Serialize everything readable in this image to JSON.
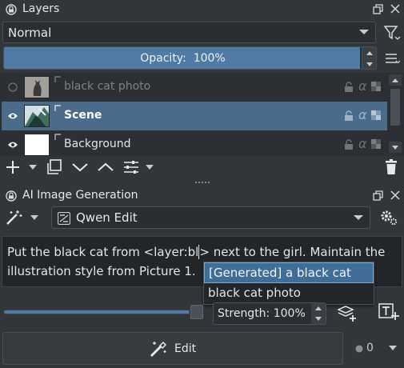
{
  "layers_docker": {
    "title": "Layers",
    "blend_mode": "Normal",
    "opacity_label": "Opacity:  100%",
    "opacity_fraction": 1.0,
    "layers": [
      {
        "name": "black cat photo",
        "visible": false,
        "selected": false
      },
      {
        "name": "Scene",
        "visible": true,
        "selected": true
      },
      {
        "name": "Background",
        "visible": true,
        "selected": false
      }
    ],
    "alpha_glyph": "α"
  },
  "ai_docker": {
    "title": "AI Image Generation",
    "model": "Qwen Edit",
    "prompt": {
      "before_cursor": "Put the black cat from <layer:bl",
      "after_cursor": "> next to the girl. Maintain the illustration style from Picture 1."
    },
    "completions": [
      "[Generated] a black cat",
      "black cat photo"
    ],
    "strength_label": "Strength: 100%",
    "strength_fraction": 1.0,
    "edit_label": "Edit",
    "queue_count": "0"
  },
  "colors": {
    "background": "#31363b",
    "selection": "#4a6b8a",
    "slider_fill": "#4e7aa3",
    "popup_highlight": "#3f6d98"
  },
  "icons": [
    "lock-icon",
    "float-icon",
    "close-icon",
    "filter-icon",
    "menu-icon",
    "eye-icon",
    "inherit-alpha-icon",
    "alpha-lock-icon",
    "checker-icon",
    "add-icon",
    "duplicate-icon",
    "move-down-icon",
    "move-up-icon",
    "properties-icon",
    "delete-icon",
    "magic-wand-icon",
    "settings-icon",
    "add-region-icon",
    "text-prompt-icon",
    "edit-brush-icon"
  ]
}
